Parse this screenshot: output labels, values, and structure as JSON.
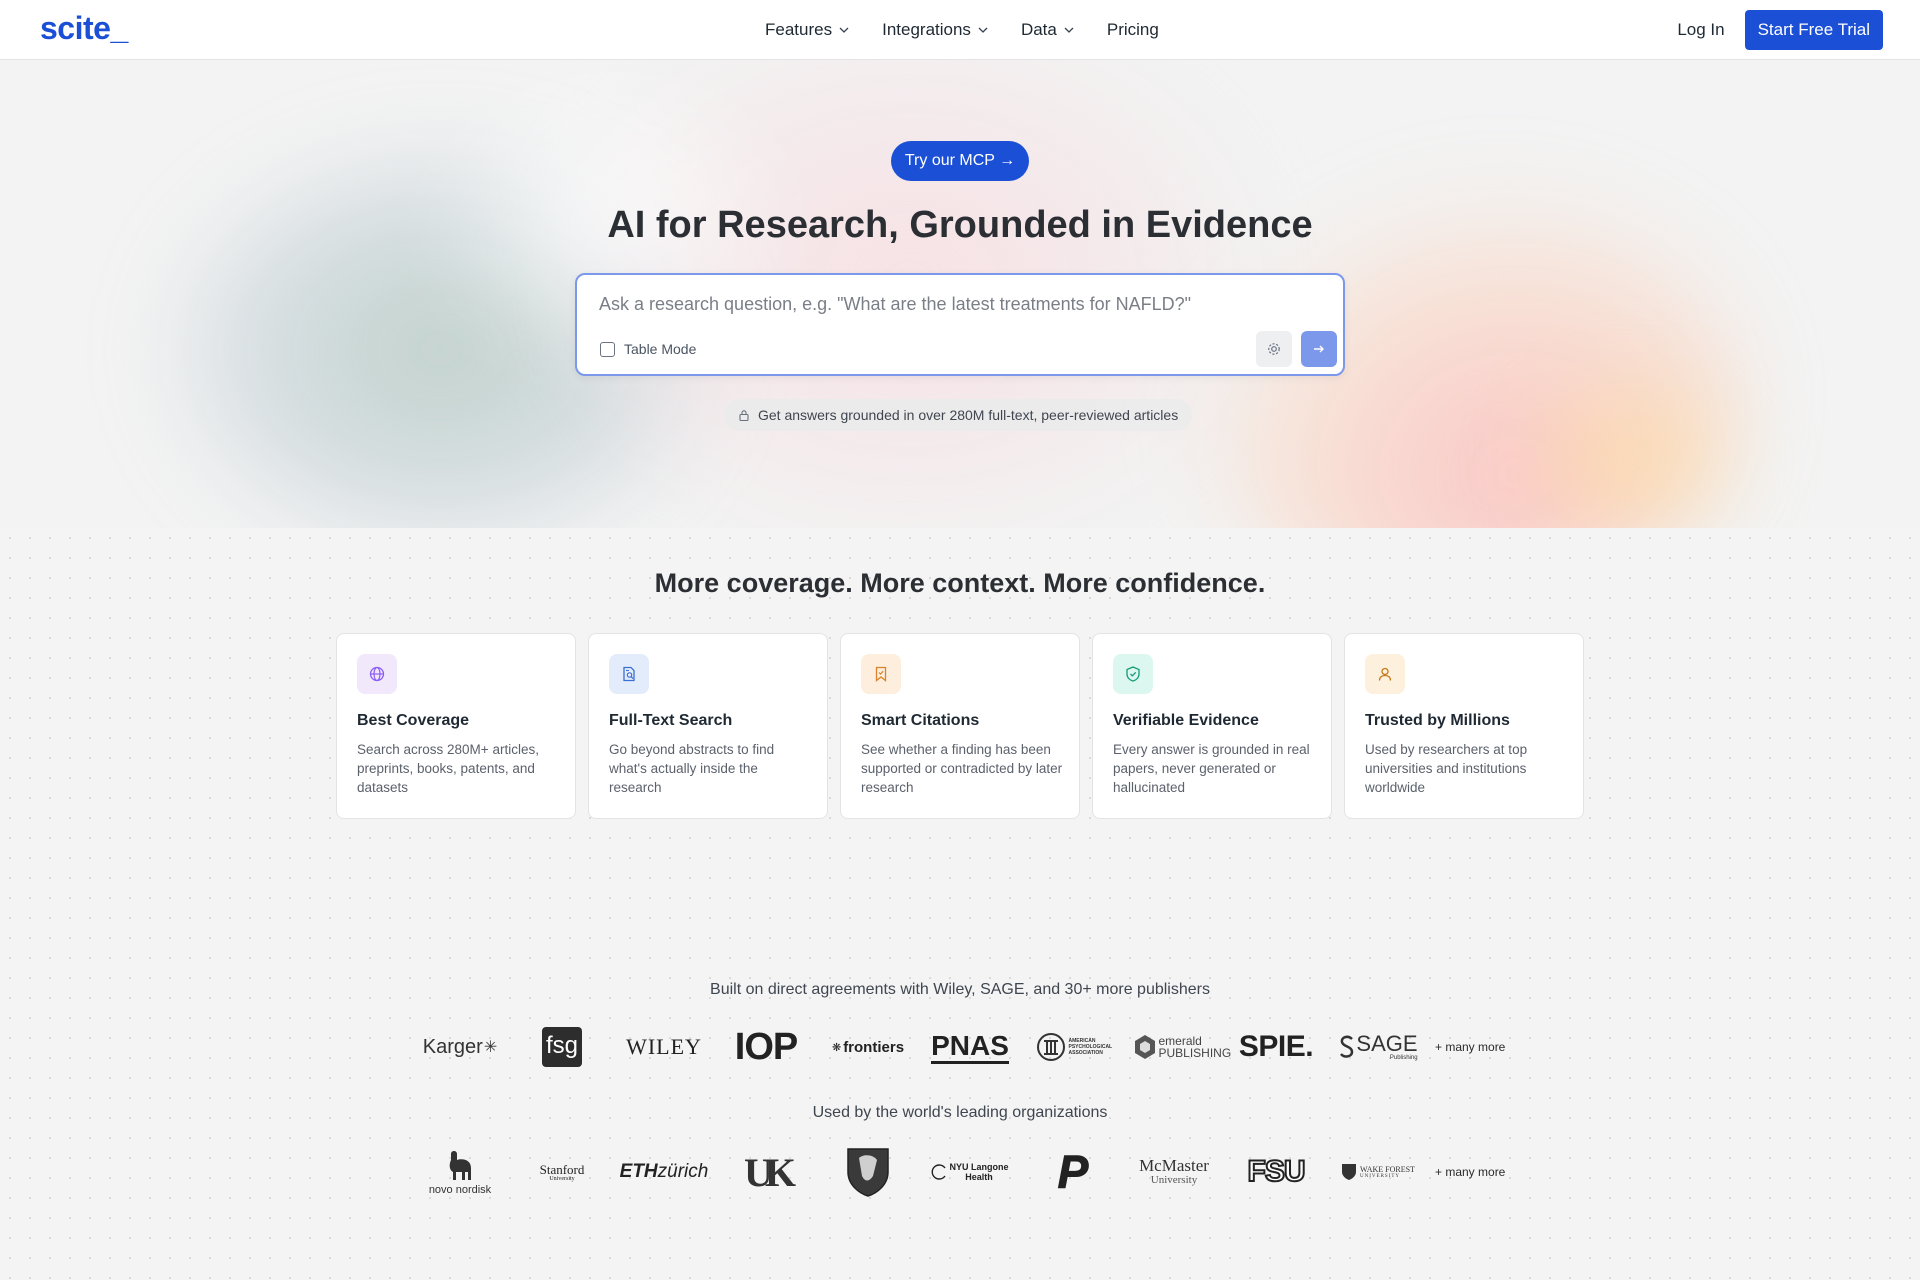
{
  "nav": {
    "logo": "scite_",
    "links": [
      {
        "label": "Features",
        "has_dropdown": true
      },
      {
        "label": "Integrations",
        "has_dropdown": true
      },
      {
        "label": "Data",
        "has_dropdown": true
      },
      {
        "label": "Pricing",
        "has_dropdown": false
      }
    ],
    "login_label": "Log In",
    "trial_label": "Start Free Trial"
  },
  "hero": {
    "mcp_label": "Try our MCP →",
    "title": "AI for Research, Grounded in Evidence",
    "search_placeholder": "Ask a research question, e.g. \"What are the latest treatments for NAFLD?\"",
    "search_value": "",
    "table_mode_label": "Table Mode",
    "table_mode_checked": false,
    "grounded_text": "Get answers grounded in over 280M full-text, peer-reviewed articles"
  },
  "coverage": {
    "title": "More coverage. More context. More confidence.",
    "cards": [
      {
        "icon": "globe-icon",
        "title": "Best Coverage",
        "desc": "Search across 280M+ articles, preprints, books, patents, and datasets",
        "icon_bg": "#f1e8fb",
        "icon_color": "#8b5cf6"
      },
      {
        "icon": "document-search-icon",
        "title": "Full-Text Search",
        "desc": "Go beyond abstracts to find what's actually inside the research",
        "icon_bg": "#e3ecfb",
        "icon_color": "#3b6fd6"
      },
      {
        "icon": "bookmark-icon",
        "title": "Smart Citations",
        "desc": "See whether a finding has been supported or contradicted by later research",
        "icon_bg": "#fdeedd",
        "icon_color": "#d9822b"
      },
      {
        "icon": "shield-check-icon",
        "title": "Verifiable Evidence",
        "desc": "Every answer is grounded in real papers, never generated or hallucinated",
        "icon_bg": "#dcf7ef",
        "icon_color": "#149b78"
      },
      {
        "icon": "user-icon",
        "title": "Trusted by Millions",
        "desc": "Used by researchers at top universities and institutions worldwide",
        "icon_bg": "#fdf0dc",
        "icon_color": "#c27a1c"
      }
    ]
  },
  "publishers": {
    "heading": "Built on direct agreements with Wiley, SAGE, and 30+ more publishers",
    "logos": [
      "Karger",
      "fsg",
      "WILEY",
      "IOP",
      "frontiers",
      "PNAS",
      "AMERICAN PSYCHOLOGICAL ASSOCIATION",
      "emerald PUBLISHING",
      "SPIE.",
      "SAGE",
      "Publishing"
    ],
    "more_label": "+ many more"
  },
  "organizations": {
    "heading": "Used by the world's leading organizations",
    "logos": [
      "novo nordisk",
      "Stanford",
      "University",
      "ETH",
      "zürich",
      "UK",
      "NYU Langone",
      "Health",
      "P",
      "McMaster",
      "University",
      "FSU",
      "WAKE FOREST",
      "UNIVERSITY"
    ],
    "more_label": "+ many more"
  },
  "colors": {
    "brand_blue": "#1a4fd6",
    "search_border": "#7b98ea",
    "page_bg": "#f4f4f4"
  }
}
